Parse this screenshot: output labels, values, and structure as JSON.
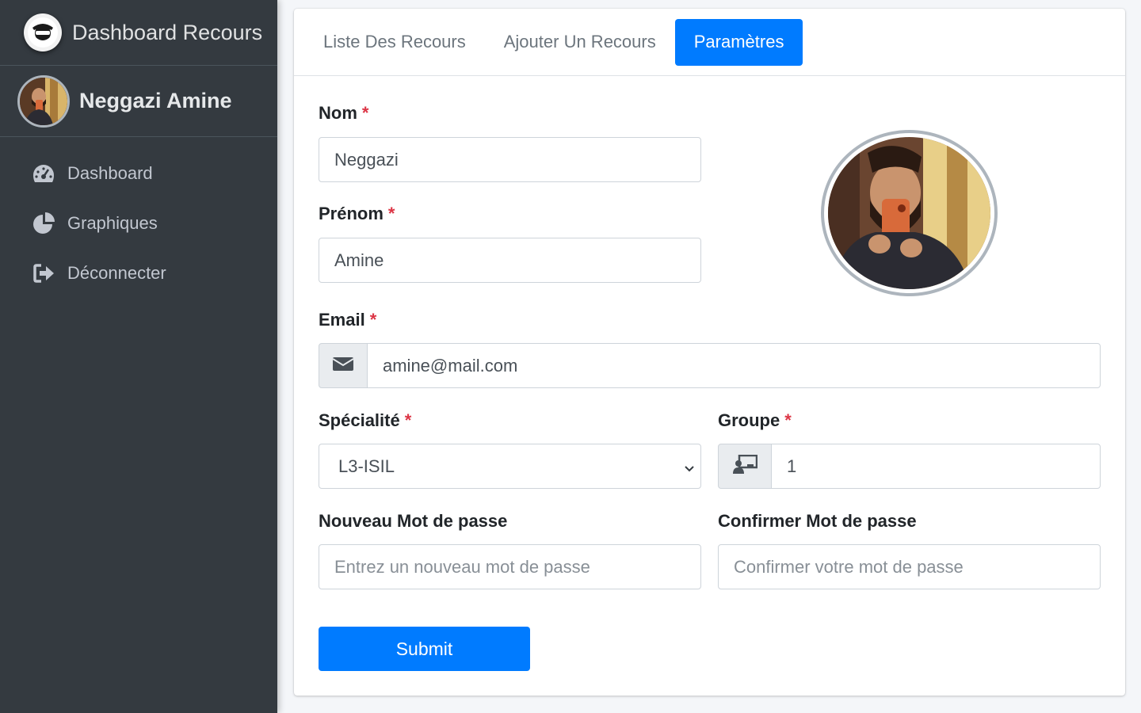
{
  "brand": {
    "title": "Dashboard Recours",
    "logo_icon": "mask-head-icon"
  },
  "user": {
    "name": "Neggazi Amine"
  },
  "nav": {
    "items": [
      {
        "label": "Dashboard",
        "icon": "tachometer-icon"
      },
      {
        "label": "Graphiques",
        "icon": "pie-chart-icon"
      },
      {
        "label": "Déconnecter",
        "icon": "sign-out-icon"
      }
    ]
  },
  "tabs": [
    {
      "label": "Liste Des Recours",
      "active": false
    },
    {
      "label": "Ajouter Un Recours",
      "active": false
    },
    {
      "label": "Paramètres",
      "active": true
    }
  ],
  "form": {
    "required_mark": "*",
    "nom": {
      "label": "Nom",
      "value": "Neggazi"
    },
    "prenom": {
      "label": "Prénom",
      "value": "Amine"
    },
    "email": {
      "label": "Email",
      "value": "amine@mail.com",
      "icon": "envelope-icon"
    },
    "specialite": {
      "label": "Spécialité",
      "value": "L3-ISIL"
    },
    "groupe": {
      "label": "Groupe",
      "value": "1",
      "icon": "chalkboard-teacher-icon"
    },
    "new_password": {
      "label": "Nouveau Mot de passe",
      "placeholder": "Entrez un nouveau mot de passe"
    },
    "confirm_password": {
      "label": "Confirmer Mot de passe",
      "placeholder": "Confirmer votre mot de passe"
    },
    "submit_label": "Submit"
  },
  "colors": {
    "sidebar_bg": "#343a40",
    "primary": "#007bff",
    "required": "#dc3545",
    "page_bg": "#f4f6f9"
  }
}
